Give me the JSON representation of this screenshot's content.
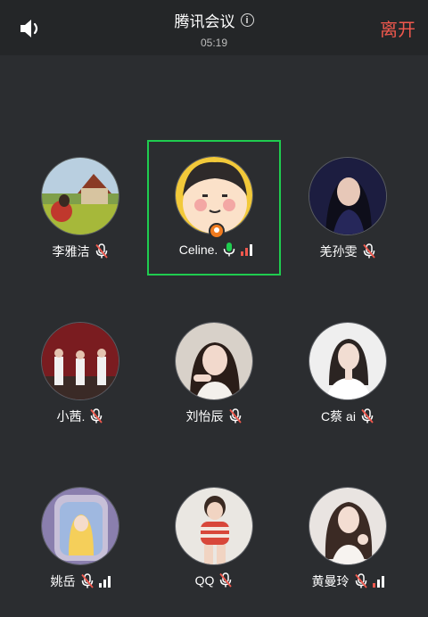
{
  "header": {
    "title": "腾讯会议",
    "timer": "05:19",
    "leave_label": "离开"
  },
  "colors": {
    "background": "#2b2d30",
    "header_background": "#242628",
    "leave": "#f0584d",
    "active_speaker_border": "#1fcc4f",
    "host_badge": "#f07b1f"
  },
  "participants": [
    {
      "name": "李雅洁",
      "mic": "muted"
    },
    {
      "name": "Celine.",
      "mic": "on",
      "signal": true,
      "host": true,
      "active": true
    },
    {
      "name": "羌孙雯",
      "mic": "muted"
    },
    {
      "name": "小茜.",
      "mic": "muted"
    },
    {
      "name": "刘怡辰",
      "mic": "muted"
    },
    {
      "name": "C蔡 ai",
      "mic": "muted"
    },
    {
      "name": "姚岳",
      "mic": "muted",
      "signal": true
    },
    {
      "name": "QQ",
      "mic": "muted"
    },
    {
      "name": "黄曼玲",
      "mic": "muted",
      "signal": true
    }
  ],
  "icons": {
    "speaker": "speaker-icon",
    "info": "info-icon",
    "mic_muted": "mic-muted-icon",
    "mic_on": "mic-on-icon",
    "signal": "signal-strength-icon",
    "host": "host-badge-icon"
  }
}
